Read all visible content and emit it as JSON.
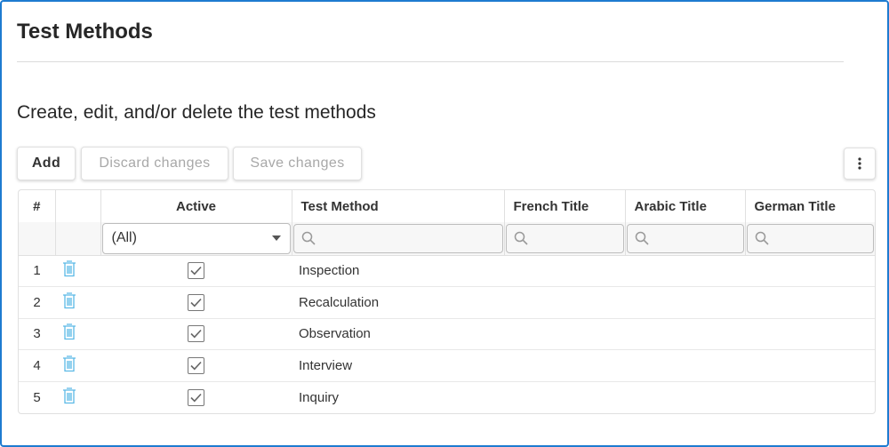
{
  "page": {
    "title": "Test Methods",
    "subtitle": "Create, edit, and/or delete the test methods"
  },
  "toolbar": {
    "add_label": "Add",
    "discard_label": "Discard changes",
    "save_label": "Save changes",
    "more_icon": "vertical-ellipsis-icon"
  },
  "grid": {
    "columns": [
      "#",
      "",
      "Active",
      "Test Method",
      "French Title",
      "Arabic Title",
      "German Title"
    ],
    "filter": {
      "active_value": "(All)",
      "search_icon": "search-icon"
    },
    "rows": [
      {
        "num": "1",
        "active": true,
        "method": "Inspection",
        "french": "",
        "arabic": "",
        "german": ""
      },
      {
        "num": "2",
        "active": true,
        "method": "Recalculation",
        "french": "",
        "arabic": "",
        "german": ""
      },
      {
        "num": "3",
        "active": true,
        "method": "Observation",
        "french": "",
        "arabic": "",
        "german": ""
      },
      {
        "num": "4",
        "active": true,
        "method": "Interview",
        "french": "",
        "arabic": "",
        "german": ""
      },
      {
        "num": "5",
        "active": true,
        "method": "Inquiry",
        "french": "",
        "arabic": "",
        "german": ""
      }
    ]
  },
  "colors": {
    "frame_border": "#1e7bd0",
    "delete_icon": "#5bb9e6",
    "disabled_text": "#a8a8a8"
  }
}
